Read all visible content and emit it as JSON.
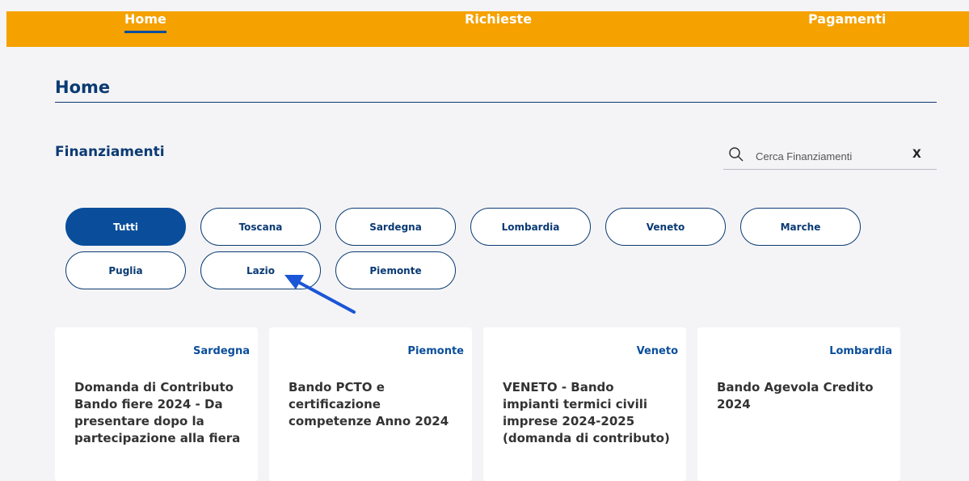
{
  "nav": {
    "items": [
      {
        "label": "Home",
        "active": true
      },
      {
        "label": "Richieste",
        "active": false
      },
      {
        "label": "Pagamenti",
        "active": false
      }
    ]
  },
  "page": {
    "title": "Home",
    "section_title": "Finanziamenti"
  },
  "search": {
    "placeholder": "Cerca Finanziamenti",
    "value": "",
    "clear_label": "X"
  },
  "filters": {
    "chips": [
      {
        "label": "Tutti",
        "active": true
      },
      {
        "label": "Toscana",
        "active": false
      },
      {
        "label": "Sardegna",
        "active": false
      },
      {
        "label": "Lombardia",
        "active": false
      },
      {
        "label": "Veneto",
        "active": false
      },
      {
        "label": "Marche",
        "active": false
      },
      {
        "label": "Puglia",
        "active": false
      },
      {
        "label": "Lazio",
        "active": false
      },
      {
        "label": "Piemonte",
        "active": false
      }
    ]
  },
  "cards": [
    {
      "region": "Sardegna",
      "title": "Domanda di Contributo Bando fiere 2024 - Da presentare dopo la partecipazione alla fiera"
    },
    {
      "region": "Piemonte",
      "title": "Bando PCTO e certificazione competenze Anno 2024"
    },
    {
      "region": "Veneto",
      "title": "VENETO - Bando impianti termici civili imprese 2024-2025 (domanda di contributo)"
    },
    {
      "region": "Lombardia",
      "title": "Bando Agevola Credito 2024"
    }
  ],
  "colors": {
    "topbar": "#f5a100",
    "primary": "#0a3a73",
    "active_chip": "#0a4e9b",
    "arrow": "#1a56d6"
  },
  "icons": {
    "search": "search-icon",
    "annotation": "arrow-pointer-icon"
  }
}
